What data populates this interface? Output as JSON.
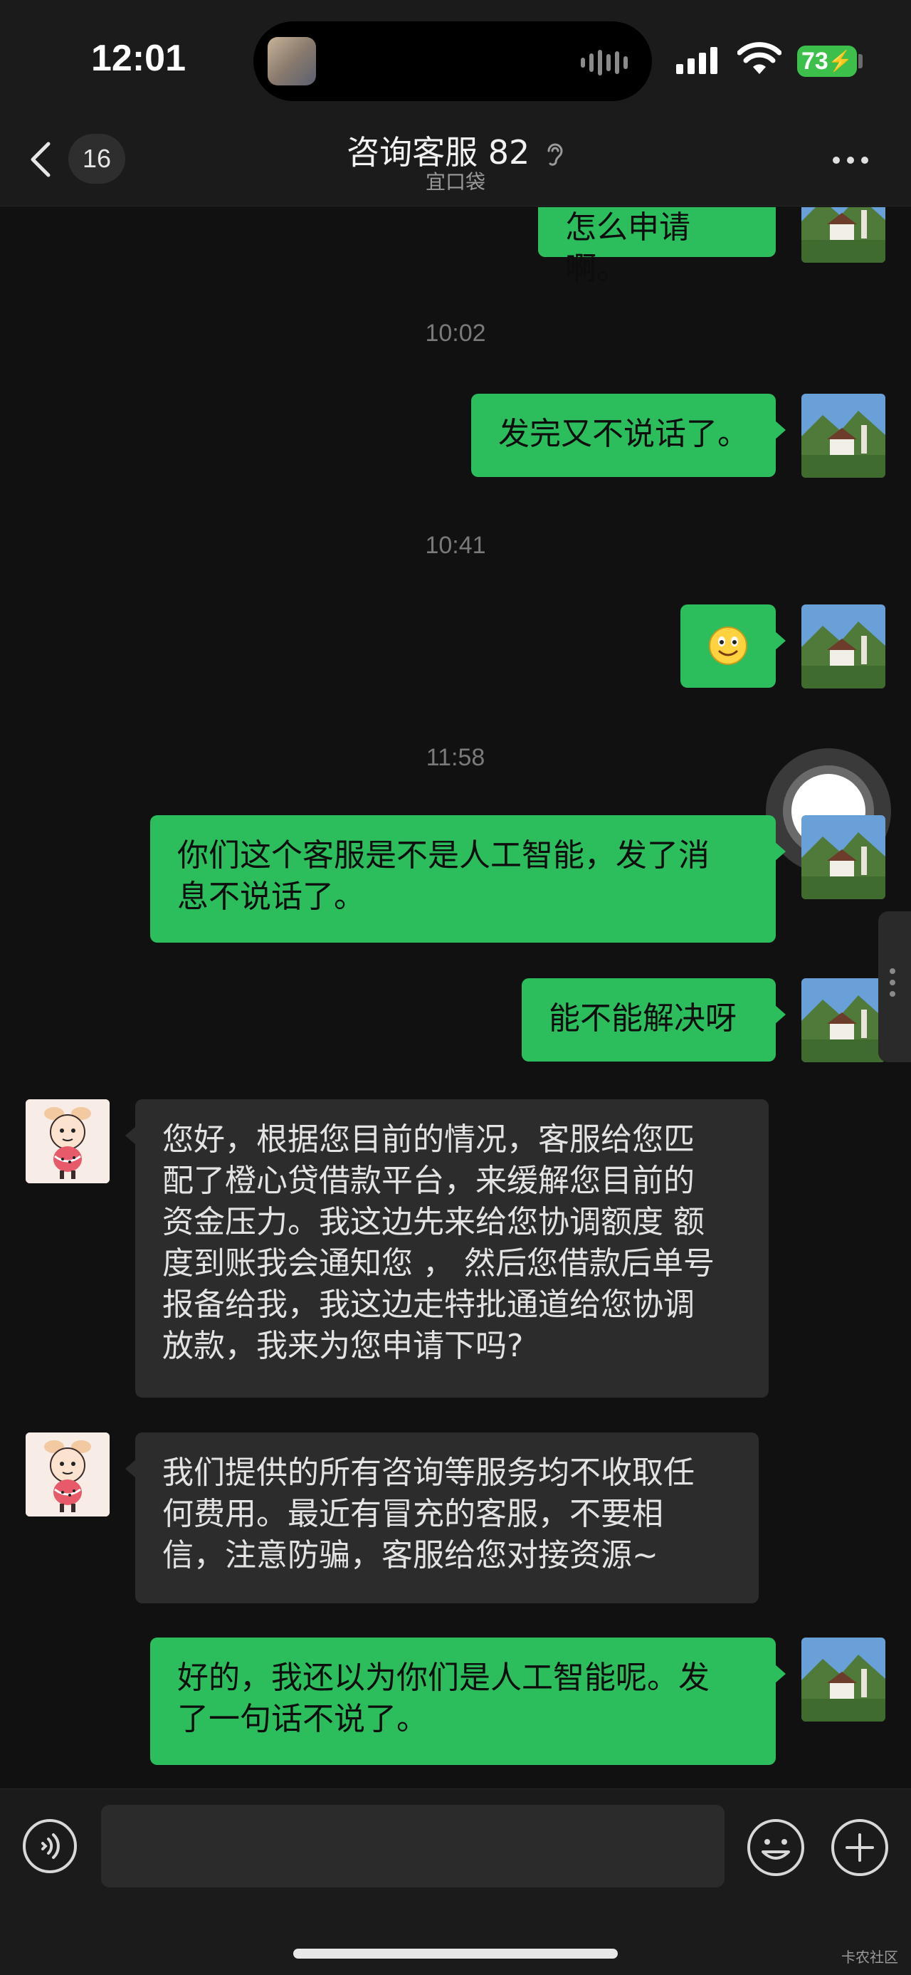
{
  "status_bar": {
    "time": "12:01",
    "battery": "73"
  },
  "nav": {
    "unread_count": "16",
    "title": "咨询客服 82",
    "subtitle": "宜口袋"
  },
  "messages": [
    {
      "type": "sent",
      "text": "怎么申请啊。"
    },
    {
      "type": "timestamp",
      "text": "10:02"
    },
    {
      "type": "sent",
      "text": "发完又不说话了。"
    },
    {
      "type": "timestamp",
      "text": "10:41"
    },
    {
      "type": "sent",
      "emoji": "smile"
    },
    {
      "type": "timestamp",
      "text": "11:58"
    },
    {
      "type": "sent",
      "lines": [
        "你们这个客服是不是人工智能，发了消",
        "息不说话了。"
      ]
    },
    {
      "type": "sent",
      "text": "能不能解决呀"
    },
    {
      "type": "received",
      "lines": [
        "您好，根据您目前的情况，客服给您匹",
        "配了橙心贷借款平台，来缓解您目前的",
        "资金压力。我这边先来给您协调额度 额",
        "度到账我会通知您 ， 然后您借款后单号",
        "报备给我，我这边走特批通道给您协调",
        "放款，我来为您申请下吗?"
      ]
    },
    {
      "type": "received",
      "lines": [
        "我们提供的所有咨询等服务均不收取任",
        "何费用。最近有冒充的客服，不要相",
        "信，注意防骗，客服给您对接资源~"
      ]
    },
    {
      "type": "sent",
      "lines": [
        "好的，我还以为你们是人工智能呢。发",
        "了一句话不说了。"
      ]
    }
  ],
  "input": {
    "placeholder": ""
  },
  "watermark": "卡农社区",
  "colors": {
    "sent_bubble": "#2cbd5c",
    "received_bubble": "#2c2c2c",
    "background": "#111111",
    "bar": "#1b1b1b"
  },
  "icons": [
    "back-chevron-icon",
    "ear-icon",
    "more-icon",
    "voice-icon",
    "emoji-icon",
    "add-icon",
    "floating-assistive-icon"
  ]
}
